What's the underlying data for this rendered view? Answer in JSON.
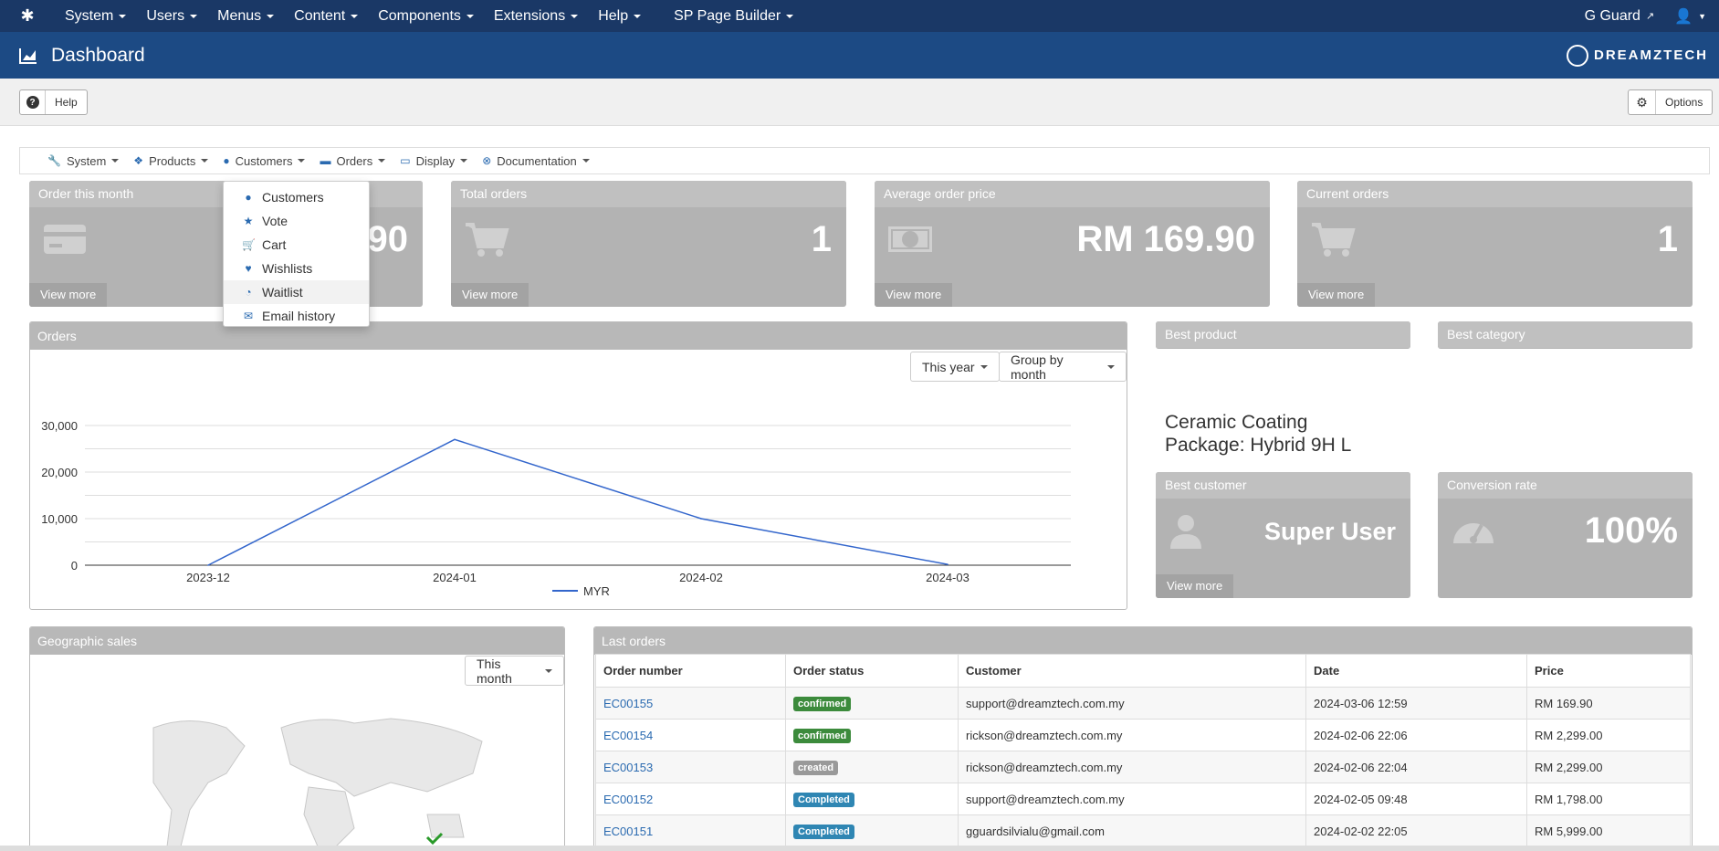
{
  "topnav": {
    "items": [
      "System",
      "Users",
      "Menus",
      "Content",
      "Components",
      "Extensions",
      "Help",
      "SP Page Builder"
    ],
    "user": "G Guard"
  },
  "header": {
    "title": "Dashboard",
    "brand": "DREAMZTECH"
  },
  "toolbar": {
    "help_label": "Help",
    "options_label": "Options"
  },
  "submenu": {
    "items": [
      "System",
      "Products",
      "Customers",
      "Orders",
      "Display",
      "Documentation"
    ]
  },
  "dropdown": {
    "items": [
      "Customers",
      "Vote",
      "Cart",
      "Wishlists",
      "Waitlist",
      "Email history"
    ],
    "active_index": 4
  },
  "cards": {
    "order_month": {
      "title": "Order this month",
      "value": "90",
      "more": "View more"
    },
    "total_orders": {
      "title": "Total orders",
      "value": "1",
      "more": "View more"
    },
    "avg_price": {
      "title": "Average order price",
      "value": "RM 169.90",
      "more": "View more"
    },
    "current_orders": {
      "title": "Current orders",
      "value": "1",
      "more": "View more"
    },
    "best_product": {
      "title": "Best product",
      "value_line1": "Ceramic Coating",
      "value_line2": "Package: Hybrid 9H L"
    },
    "best_category": {
      "title": "Best category"
    },
    "best_customer": {
      "title": "Best customer",
      "value": "Super User",
      "more": "View more"
    },
    "conversion": {
      "title": "Conversion rate",
      "value": "100%"
    }
  },
  "orders_panel": {
    "title": "Orders",
    "period_btn": "This year",
    "group_btn": "Group by month"
  },
  "chart_data": {
    "type": "line",
    "x": [
      "2023-12",
      "2024-01",
      "2024-02",
      "2024-03"
    ],
    "series": [
      {
        "name": "MYR",
        "values": [
          0,
          27000,
          10000,
          170
        ],
        "color": "#3366cc"
      }
    ],
    "yticks": [
      "0",
      "10,000",
      "20,000",
      "30,000"
    ],
    "ylim": [
      0,
      30000
    ],
    "grid": true,
    "legend": "bottom"
  },
  "geo_panel": {
    "title": "Geographic sales",
    "period_btn": "This month"
  },
  "last_orders": {
    "title": "Last orders",
    "headers": [
      "Order number",
      "Order status",
      "Customer",
      "Date",
      "Price"
    ],
    "rows": [
      {
        "number": "EC00155",
        "status": "confirmed",
        "status_color": "#3c8b3c",
        "customer": "support@dreamztech.com.my",
        "date": "2024-03-06 12:59",
        "price": "RM 169.90"
      },
      {
        "number": "EC00154",
        "status": "confirmed",
        "status_color": "#3c8b3c",
        "customer": "rickson@dreamztech.com.my",
        "date": "2024-02-06 22:06",
        "price": "RM 2,299.00"
      },
      {
        "number": "EC00153",
        "status": "created",
        "status_color": "#999999",
        "customer": "rickson@dreamztech.com.my",
        "date": "2024-02-06 22:04",
        "price": "RM 2,299.00"
      },
      {
        "number": "EC00152",
        "status": "Completed",
        "status_color": "#2f86b3",
        "customer": "support@dreamztech.com.my",
        "date": "2024-02-05 09:48",
        "price": "RM 1,798.00"
      },
      {
        "number": "EC00151",
        "status": "Completed",
        "status_color": "#2f86b3",
        "customer": "gguardsilvialu@gmail.com",
        "date": "2024-02-02 22:05",
        "price": "RM 5,999.00"
      }
    ]
  }
}
